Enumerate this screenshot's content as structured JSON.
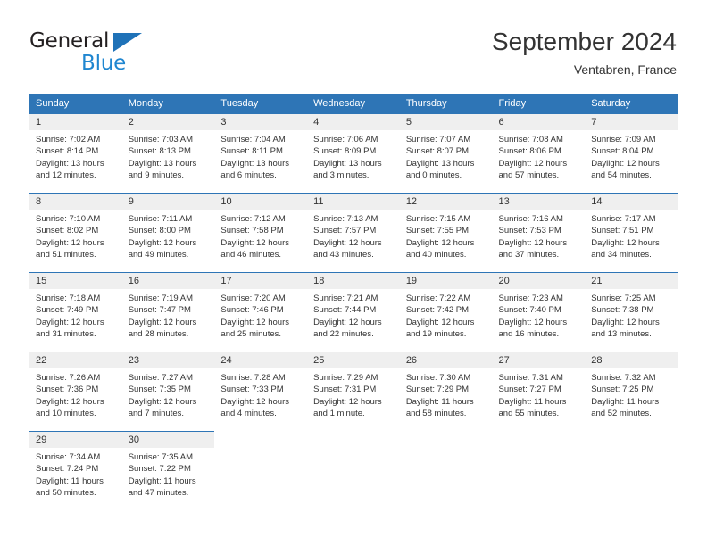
{
  "brand": {
    "line1": "General",
    "line2": "Blue",
    "triangle_color": "#1f72b8"
  },
  "header": {
    "title": "September 2024",
    "subtitle": "Ventabren, France"
  },
  "theme": {
    "header_blue": "#2e75b6",
    "daynum_gray": "#efefef",
    "text": "#333333"
  },
  "calendar": {
    "weekday_headers": [
      "Sunday",
      "Monday",
      "Tuesday",
      "Wednesday",
      "Thursday",
      "Friday",
      "Saturday"
    ],
    "labels": {
      "sunrise": "Sunrise:",
      "sunset": "Sunset:",
      "daylight": "Daylight:"
    },
    "weeks": [
      [
        {
          "day": "1",
          "sunrise": "Sunrise: 7:02 AM",
          "sunset": "Sunset: 8:14 PM",
          "daylight1": "Daylight: 13 hours",
          "daylight2": "and 12 minutes."
        },
        {
          "day": "2",
          "sunrise": "Sunrise: 7:03 AM",
          "sunset": "Sunset: 8:13 PM",
          "daylight1": "Daylight: 13 hours",
          "daylight2": "and 9 minutes."
        },
        {
          "day": "3",
          "sunrise": "Sunrise: 7:04 AM",
          "sunset": "Sunset: 8:11 PM",
          "daylight1": "Daylight: 13 hours",
          "daylight2": "and 6 minutes."
        },
        {
          "day": "4",
          "sunrise": "Sunrise: 7:06 AM",
          "sunset": "Sunset: 8:09 PM",
          "daylight1": "Daylight: 13 hours",
          "daylight2": "and 3 minutes."
        },
        {
          "day": "5",
          "sunrise": "Sunrise: 7:07 AM",
          "sunset": "Sunset: 8:07 PM",
          "daylight1": "Daylight: 13 hours",
          "daylight2": "and 0 minutes."
        },
        {
          "day": "6",
          "sunrise": "Sunrise: 7:08 AM",
          "sunset": "Sunset: 8:06 PM",
          "daylight1": "Daylight: 12 hours",
          "daylight2": "and 57 minutes."
        },
        {
          "day": "7",
          "sunrise": "Sunrise: 7:09 AM",
          "sunset": "Sunset: 8:04 PM",
          "daylight1": "Daylight: 12 hours",
          "daylight2": "and 54 minutes."
        }
      ],
      [
        {
          "day": "8",
          "sunrise": "Sunrise: 7:10 AM",
          "sunset": "Sunset: 8:02 PM",
          "daylight1": "Daylight: 12 hours",
          "daylight2": "and 51 minutes."
        },
        {
          "day": "9",
          "sunrise": "Sunrise: 7:11 AM",
          "sunset": "Sunset: 8:00 PM",
          "daylight1": "Daylight: 12 hours",
          "daylight2": "and 49 minutes."
        },
        {
          "day": "10",
          "sunrise": "Sunrise: 7:12 AM",
          "sunset": "Sunset: 7:58 PM",
          "daylight1": "Daylight: 12 hours",
          "daylight2": "and 46 minutes."
        },
        {
          "day": "11",
          "sunrise": "Sunrise: 7:13 AM",
          "sunset": "Sunset: 7:57 PM",
          "daylight1": "Daylight: 12 hours",
          "daylight2": "and 43 minutes."
        },
        {
          "day": "12",
          "sunrise": "Sunrise: 7:15 AM",
          "sunset": "Sunset: 7:55 PM",
          "daylight1": "Daylight: 12 hours",
          "daylight2": "and 40 minutes."
        },
        {
          "day": "13",
          "sunrise": "Sunrise: 7:16 AM",
          "sunset": "Sunset: 7:53 PM",
          "daylight1": "Daylight: 12 hours",
          "daylight2": "and 37 minutes."
        },
        {
          "day": "14",
          "sunrise": "Sunrise: 7:17 AM",
          "sunset": "Sunset: 7:51 PM",
          "daylight1": "Daylight: 12 hours",
          "daylight2": "and 34 minutes."
        }
      ],
      [
        {
          "day": "15",
          "sunrise": "Sunrise: 7:18 AM",
          "sunset": "Sunset: 7:49 PM",
          "daylight1": "Daylight: 12 hours",
          "daylight2": "and 31 minutes."
        },
        {
          "day": "16",
          "sunrise": "Sunrise: 7:19 AM",
          "sunset": "Sunset: 7:47 PM",
          "daylight1": "Daylight: 12 hours",
          "daylight2": "and 28 minutes."
        },
        {
          "day": "17",
          "sunrise": "Sunrise: 7:20 AM",
          "sunset": "Sunset: 7:46 PM",
          "daylight1": "Daylight: 12 hours",
          "daylight2": "and 25 minutes."
        },
        {
          "day": "18",
          "sunrise": "Sunrise: 7:21 AM",
          "sunset": "Sunset: 7:44 PM",
          "daylight1": "Daylight: 12 hours",
          "daylight2": "and 22 minutes."
        },
        {
          "day": "19",
          "sunrise": "Sunrise: 7:22 AM",
          "sunset": "Sunset: 7:42 PM",
          "daylight1": "Daylight: 12 hours",
          "daylight2": "and 19 minutes."
        },
        {
          "day": "20",
          "sunrise": "Sunrise: 7:23 AM",
          "sunset": "Sunset: 7:40 PM",
          "daylight1": "Daylight: 12 hours",
          "daylight2": "and 16 minutes."
        },
        {
          "day": "21",
          "sunrise": "Sunrise: 7:25 AM",
          "sunset": "Sunset: 7:38 PM",
          "daylight1": "Daylight: 12 hours",
          "daylight2": "and 13 minutes."
        }
      ],
      [
        {
          "day": "22",
          "sunrise": "Sunrise: 7:26 AM",
          "sunset": "Sunset: 7:36 PM",
          "daylight1": "Daylight: 12 hours",
          "daylight2": "and 10 minutes."
        },
        {
          "day": "23",
          "sunrise": "Sunrise: 7:27 AM",
          "sunset": "Sunset: 7:35 PM",
          "daylight1": "Daylight: 12 hours",
          "daylight2": "and 7 minutes."
        },
        {
          "day": "24",
          "sunrise": "Sunrise: 7:28 AM",
          "sunset": "Sunset: 7:33 PM",
          "daylight1": "Daylight: 12 hours",
          "daylight2": "and 4 minutes."
        },
        {
          "day": "25",
          "sunrise": "Sunrise: 7:29 AM",
          "sunset": "Sunset: 7:31 PM",
          "daylight1": "Daylight: 12 hours",
          "daylight2": "and 1 minute."
        },
        {
          "day": "26",
          "sunrise": "Sunrise: 7:30 AM",
          "sunset": "Sunset: 7:29 PM",
          "daylight1": "Daylight: 11 hours",
          "daylight2": "and 58 minutes."
        },
        {
          "day": "27",
          "sunrise": "Sunrise: 7:31 AM",
          "sunset": "Sunset: 7:27 PM",
          "daylight1": "Daylight: 11 hours",
          "daylight2": "and 55 minutes."
        },
        {
          "day": "28",
          "sunrise": "Sunrise: 7:32 AM",
          "sunset": "Sunset: 7:25 PM",
          "daylight1": "Daylight: 11 hours",
          "daylight2": "and 52 minutes."
        }
      ],
      [
        {
          "day": "29",
          "sunrise": "Sunrise: 7:34 AM",
          "sunset": "Sunset: 7:24 PM",
          "daylight1": "Daylight: 11 hours",
          "daylight2": "and 50 minutes."
        },
        {
          "day": "30",
          "sunrise": "Sunrise: 7:35 AM",
          "sunset": "Sunset: 7:22 PM",
          "daylight1": "Daylight: 11 hours",
          "daylight2": "and 47 minutes."
        },
        {
          "day": "",
          "sunrise": "",
          "sunset": "",
          "daylight1": "",
          "daylight2": ""
        },
        {
          "day": "",
          "sunrise": "",
          "sunset": "",
          "daylight1": "",
          "daylight2": ""
        },
        {
          "day": "",
          "sunrise": "",
          "sunset": "",
          "daylight1": "",
          "daylight2": ""
        },
        {
          "day": "",
          "sunrise": "",
          "sunset": "",
          "daylight1": "",
          "daylight2": ""
        },
        {
          "day": "",
          "sunrise": "",
          "sunset": "",
          "daylight1": "",
          "daylight2": ""
        }
      ]
    ]
  }
}
